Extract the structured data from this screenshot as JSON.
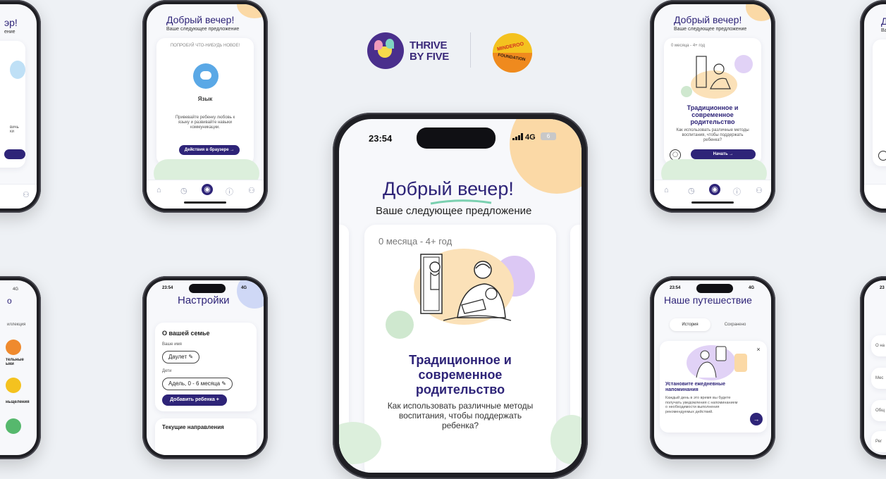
{
  "logos": {
    "thrive_line1": "THRIVE",
    "thrive_line2": "BY FIVE",
    "minderoo_top": "MINDEROO",
    "minderoo_bottom": "FOUNDATION"
  },
  "colors": {
    "navy": "#2e2478",
    "peach": "#fbd9a6",
    "lilac": "#d9c9f2",
    "mint": "#cfe8cf",
    "background": "#eef1f5"
  },
  "main_phone": {
    "status_time": "23:54",
    "status_network": "4G",
    "status_battery": "6",
    "greeting": "Добрый вечер!",
    "subtitle": "Ваше следующее предложение",
    "card_age": "0 месяца - 4+ год",
    "card_title": "Традиционное и современное родительство",
    "card_desc": "Как использовать различные методы воспитания, чтобы поддержать ребенка?"
  },
  "phone_top_left": {
    "greeting": "Добрый вечер!",
    "subtitle": "Ваше следующее предложение",
    "card_tag": "ПОПРОБУЙ ЧТО-НИБУДЬ НОВОЕ!",
    "card_title": "Язык",
    "card_desc": "Привевайте ребенку любовь к языку и развивайте навыки коммуникации.",
    "button": "Действия в браузере →"
  },
  "phone_top_right": {
    "greeting": "Добрый вечер!",
    "subtitle": "Ваше следующее предложение",
    "card_age": "0 месяца - 4+ год",
    "card_title": "Традиционное и современное родительство",
    "card_desc": "Как использовать различные методы воспитания, чтобы поддержать ребенка?",
    "button": "Начать →"
  },
  "phone_bottom_left": {
    "status_time": "23:54",
    "status_network": "4G",
    "title": "Настройки",
    "section_title": "О вашей семье",
    "name_label": "Ваше имя",
    "name_value": "Даулет",
    "kids_label": "Дети",
    "kids_value": "Адель, 0 - 6 месяца",
    "add_button": "Добавить ребенка +",
    "section2_title": "Текущие направления"
  },
  "phone_bottom_right": {
    "status_time": "23:54",
    "status_network": "4G",
    "title": "Наше путешествие",
    "tab_history": "История",
    "tab_saved": "Сохранено",
    "card_title": "Установите ежедневные напоминания",
    "card_desc": "Каждый день в это время вы будете получать уведомления с напоминанием о необходимости выполнения рекомендуемых действий.",
    "close_icon": "×",
    "arrow_icon": "→"
  },
  "edge_left_top": {
    "greeting_part": "эр!",
    "subtitle_part": "ение",
    "text_part": "вичь\nки"
  },
  "edge_left_bottom": {
    "status_network": "4G",
    "title_part": "о",
    "label_part": "иллекция",
    "item1": "тельные\nыки",
    "item2": "ньщеления"
  },
  "edge_right_top": {
    "greeting_part": "Д",
    "subtitle_part": "Ва"
  },
  "edge_right_bottom": {
    "status_time": "23",
    "row1": "О на",
    "row2": "Мес",
    "row3": "Общ",
    "row4": "Рег"
  }
}
